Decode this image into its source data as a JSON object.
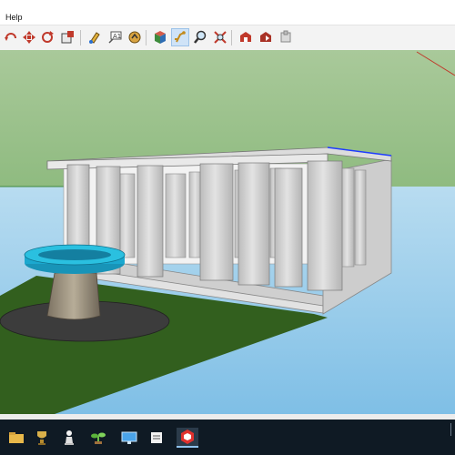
{
  "menubar": {
    "items": [
      {
        "label": "Help"
      }
    ]
  },
  "toolbar": {
    "buttons": [
      {
        "name": "orbit-icon"
      },
      {
        "name": "pan-icon"
      },
      {
        "name": "rotate-icon"
      },
      {
        "name": "scale-icon"
      },
      {
        "name": "paint-bucket-icon"
      },
      {
        "name": "text-tool-icon"
      },
      {
        "name": "3d-text-icon"
      },
      {
        "name": "section-plane-icon"
      },
      {
        "name": "walk-icon"
      },
      {
        "name": "zoom-icon"
      },
      {
        "name": "zoom-extents-icon"
      },
      {
        "name": "warehouse-icon"
      },
      {
        "name": "share-model-icon"
      },
      {
        "name": "extension-icon"
      }
    ]
  },
  "scene": {
    "colors": {
      "sky_top": "#a9c99a",
      "sky_bottom": "#8fbb80",
      "ground_horizon": "#b8dcf0",
      "ground_far": "#7fbfe6",
      "lawn": "#325f1e",
      "column": "#d6d6d6",
      "fountain_water": "#19a6c9",
      "edge_highlight": "#1e3cff"
    }
  },
  "taskbar": {
    "items": [
      {
        "name": "taskbar-folder-icon"
      },
      {
        "name": "taskbar-trophy-icon"
      },
      {
        "name": "taskbar-chess-icon"
      },
      {
        "name": "taskbar-plant-icon"
      },
      {
        "name": "taskbar-monitor-icon"
      },
      {
        "name": "taskbar-notes-icon"
      },
      {
        "name": "taskbar-document-icon"
      },
      {
        "name": "taskbar-sketchup-icon"
      }
    ]
  }
}
